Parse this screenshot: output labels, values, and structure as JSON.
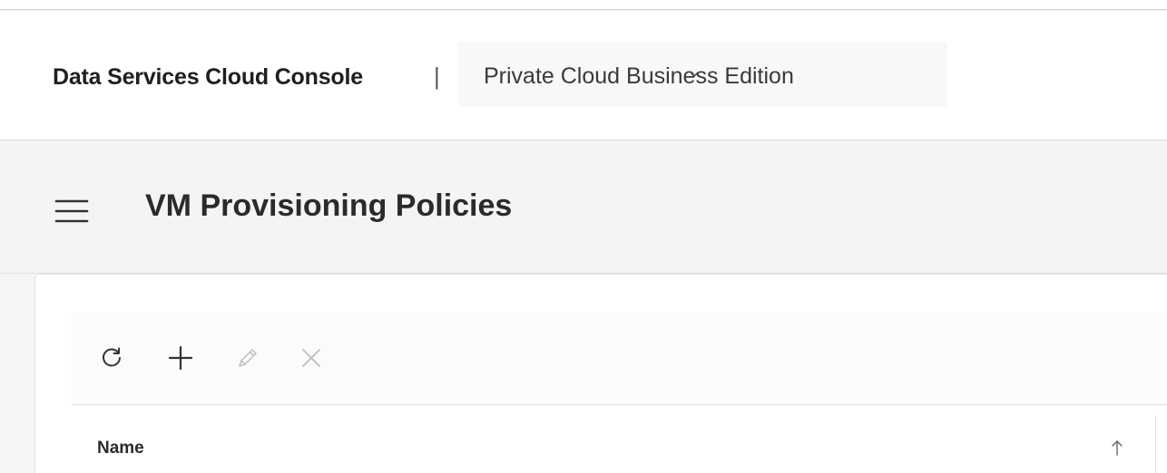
{
  "header": {
    "brand": "Data Services Cloud Console",
    "separator": "|",
    "app_switcher": {
      "label": "Private Cloud Business Edition",
      "icon": "chevron-down-icon"
    }
  },
  "title_bar": {
    "menu_icon": "menu-icon",
    "title": "VM Provisioning Policies"
  },
  "toolbar": {
    "buttons": [
      {
        "name": "refresh",
        "icon": "refresh-icon",
        "enabled": true
      },
      {
        "name": "add",
        "icon": "plus-icon",
        "enabled": true
      },
      {
        "name": "edit",
        "icon": "pencil-icon",
        "enabled": false
      },
      {
        "name": "delete",
        "icon": "close-icon",
        "enabled": false
      }
    ]
  },
  "table": {
    "columns": [
      {
        "label": "Name",
        "sort": "ascending",
        "sort_icon": "arrow-up-icon"
      }
    ]
  },
  "colors": {
    "header_bg": "#ffffff",
    "title_bar_bg": "#f4f4f4",
    "text_primary": "#2b2b2b",
    "icon_enabled": "#333333",
    "icon_disabled": "#bdbdbd"
  }
}
